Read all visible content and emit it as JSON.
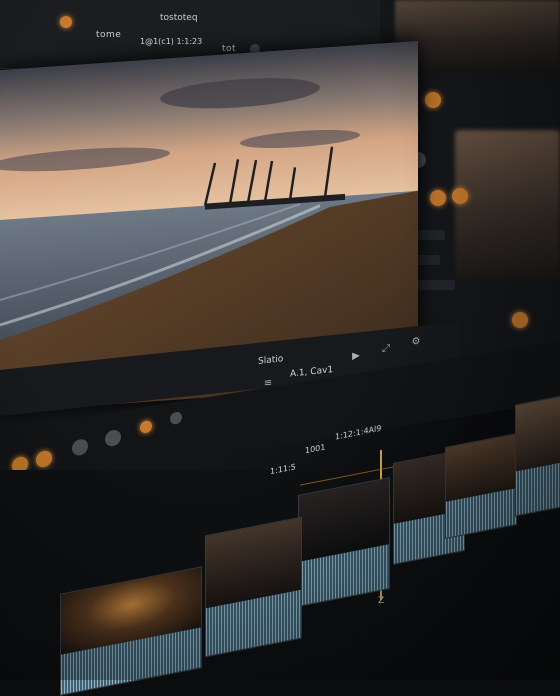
{
  "toolbar": {
    "title": "tostoteq",
    "info_left": "tome",
    "info_mid": "1@1(c1) 1:1:23",
    "info_right": "tot"
  },
  "viewer": {
    "title": "Sunset beach preview"
  },
  "transport": {
    "clip_name": "Slatio",
    "track_label": "A.1, Cav1"
  },
  "timeline": {
    "timecodes": [
      "1001",
      "1:12:1:4Al9",
      "1:11:5"
    ],
    "end_marker": "Z"
  },
  "colors": {
    "accent": "#c77a2c",
    "playhead": "#e0b24a",
    "panel": "#1b1d20",
    "background": "#0b0c0e"
  },
  "icons": [
    "play-icon",
    "pause-icon",
    "list-icon",
    "gear-icon",
    "fullscreen-icon"
  ]
}
